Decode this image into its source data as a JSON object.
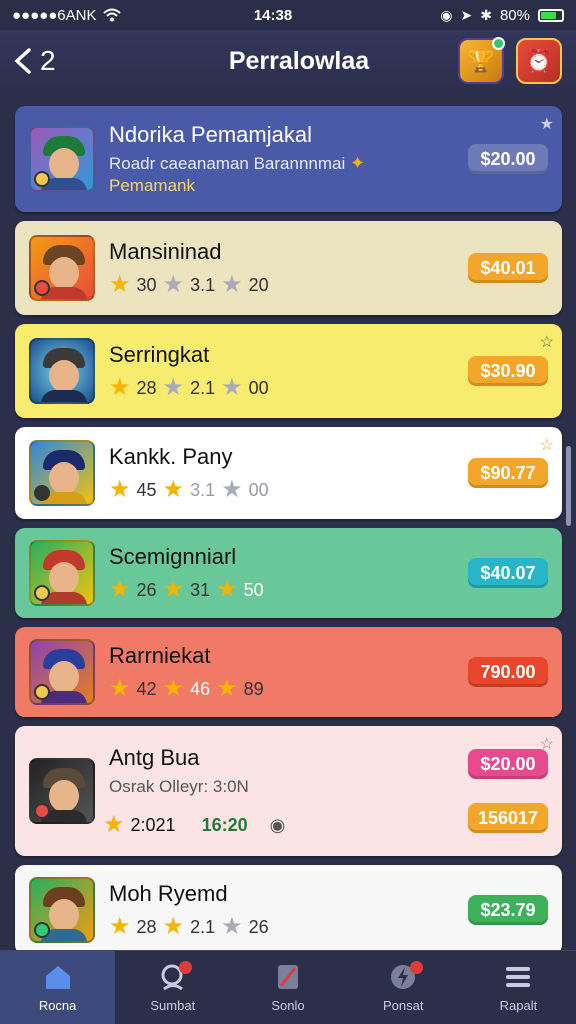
{
  "status": {
    "carrier": "●●●●●6ANK",
    "time": "14:38",
    "battery": "80%"
  },
  "header": {
    "back_count": "2",
    "title": "Perralowlaa"
  },
  "cards": [
    {
      "name": "Ndorika Pemamjakal",
      "sub1": "Roadr caeanaman Barannnmai",
      "sub2": "Pemamank",
      "price": "$20.00",
      "bg": "#4a5aa8",
      "price_color": "#6d7ab8",
      "text_color": "#ffffff"
    },
    {
      "name": "Mansininad",
      "r1": "30",
      "r2": "3.1",
      "r3": "20",
      "price": "$40.01",
      "bg": "#ece4be",
      "price_color": "#f4a62a"
    },
    {
      "name": "Serringkat",
      "r1": "28",
      "r2": "2.1",
      "r3": "00",
      "price": "$30.90",
      "bg": "#f8ec6e",
      "price_color": "#f4a62a"
    },
    {
      "name": "Kankk. Pany",
      "r1": "45",
      "r2": "3.1",
      "r3": "00",
      "price": "$90.77",
      "bg": "#ffffff",
      "price_color": "#f4a62a"
    },
    {
      "name": "Scemignniarl",
      "r1": "26",
      "r2": "31",
      "r3": "50",
      "price": "$40.07",
      "bg": "#68c89a",
      "price_color": "#28b5c8"
    },
    {
      "name": "Rarrniekat",
      "r1": "42",
      "r2": "46",
      "r3": "89",
      "price": "790.00",
      "bg": "#f07a66",
      "price_color": "#e8472b"
    },
    {
      "name": "Antg Bua",
      "sub1": "Osrak Olleyr: 3:0N",
      "r1": "2:021",
      "r2": "16:20",
      "price": "$20.00",
      "price2": "156017",
      "bg": "#fde4e4",
      "price_color": "#e84a8f",
      "price2_color": "#f4a62a"
    },
    {
      "name": "Moh Ryemd",
      "r1": "28",
      "r2": "2.1",
      "r3": "26",
      "price": "$23.79",
      "bg": "#f7f7f7",
      "price_color": "#3db25a"
    }
  ],
  "tabs": [
    {
      "label": "Rocna"
    },
    {
      "label": "Sumbat"
    },
    {
      "label": "Sonlo"
    },
    {
      "label": "Ponsat"
    },
    {
      "label": "Rapalt"
    }
  ]
}
